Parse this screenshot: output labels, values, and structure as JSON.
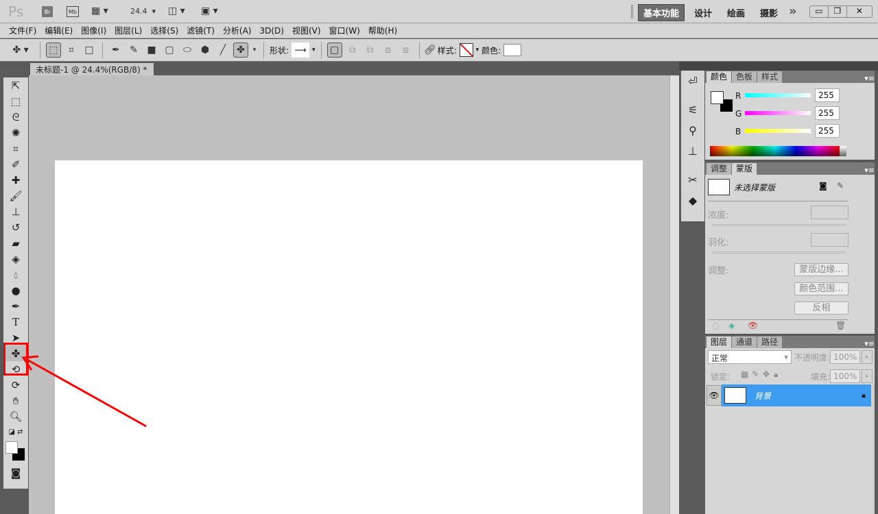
{
  "titlebar": {
    "logo": "Ps",
    "bridge": "Br",
    "minibridge": "Mb",
    "zoom": "24.4",
    "workspaces": [
      "基本功能",
      "设计",
      "绘画",
      "摄影"
    ],
    "more": "»"
  },
  "menu": [
    "文件(F)",
    "编辑(E)",
    "图像(I)",
    "图层(L)",
    "选择(S)",
    "滤镜(T)",
    "分析(A)",
    "3D(D)",
    "视图(V)",
    "窗口(W)",
    "帮助(H)"
  ],
  "options": {
    "shape_label": "形状:",
    "style_label": "样式:",
    "color_label": "颜色:"
  },
  "document": {
    "tab_title": "未标题-1 @ 24.4%(RGB/8) *"
  },
  "color_panel": {
    "tabs": [
      "颜色",
      "色板",
      "样式"
    ],
    "channels": [
      {
        "label": "R",
        "value": "255"
      },
      {
        "label": "G",
        "value": "255"
      },
      {
        "label": "B",
        "value": "255"
      }
    ]
  },
  "masks_panel": {
    "tabs": [
      "调整",
      "蒙版"
    ],
    "status": "未选择蒙版",
    "density_label": "浓度:",
    "feather_label": "羽化:",
    "refine_label": "调整:",
    "buttons": [
      "蒙版边缘...",
      "颜色范围...",
      "反相"
    ]
  },
  "layers_panel": {
    "tabs": [
      "图层",
      "通道",
      "路径"
    ],
    "blend_mode": "正常",
    "opacity_label": "不透明度:",
    "opacity": "100%",
    "lock_label": "锁定:",
    "fill_label": "填充:",
    "fill": "100%",
    "layers": [
      {
        "name": "背景",
        "locked": true,
        "visible": true
      }
    ]
  },
  "colors": {
    "accent": "#3d9cf0",
    "highlight": "#ff0000"
  }
}
